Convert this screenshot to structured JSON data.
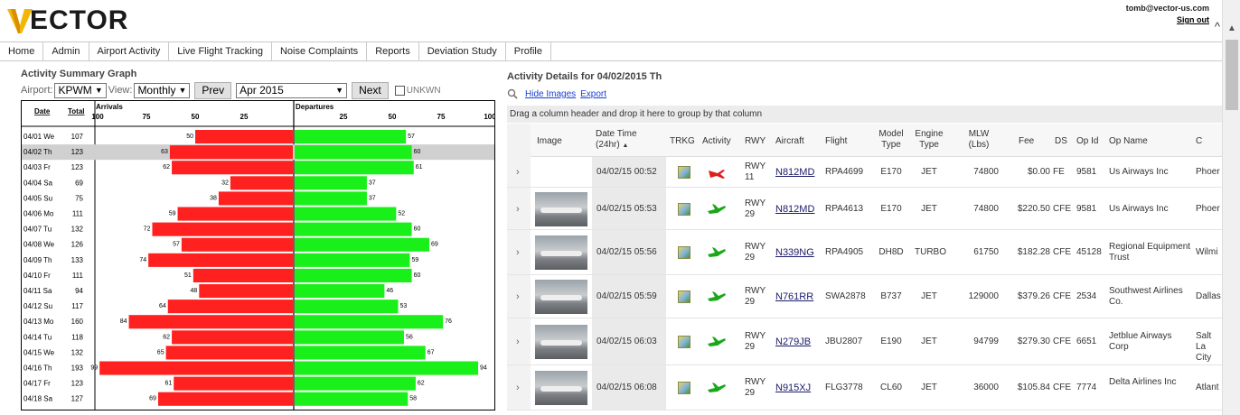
{
  "header": {
    "logo_text": "ECTOR",
    "user_email": "tomb@vector-us.com",
    "sign_out": "Sign out"
  },
  "nav": [
    "Home",
    "Admin",
    "Airport Activity",
    "Live Flight Tracking",
    "Noise Complaints",
    "Reports",
    "Deviation Study",
    "Profile"
  ],
  "summary": {
    "title": "Activity Summary Graph",
    "airport_label": "Airport:",
    "airport_value": "KPWM",
    "view_label": "View:",
    "view_value": "Monthly",
    "prev_label": "Prev",
    "month_value": "Apr 2015",
    "next_label": "Next",
    "unkwn_label": "UNKWN"
  },
  "chart_data": {
    "type": "bar",
    "columns": {
      "date": "Date",
      "total": "Total"
    },
    "arrivals_label": "Arrivals",
    "departures_label": "Departures",
    "arrival_ticks": [
      "100",
      "75",
      "50",
      "25"
    ],
    "departure_ticks": [
      "25",
      "50",
      "75",
      "100"
    ],
    "categories": [
      "04/01 We",
      "04/02 Th",
      "04/03 Fr",
      "04/04 Sa",
      "04/05 Su",
      "04/06 Mo",
      "04/07 Tu",
      "04/08 We",
      "04/09 Th",
      "04/10 Fr",
      "04/11 Sa",
      "04/12 Su",
      "04/13 Mo",
      "04/14 Tu",
      "04/15 We",
      "04/16 Th",
      "04/17 Fr",
      "04/18 Sa"
    ],
    "totals": [
      107,
      123,
      123,
      69,
      75,
      111,
      132,
      126,
      133,
      111,
      94,
      117,
      160,
      118,
      132,
      193,
      123,
      127
    ],
    "series": [
      {
        "name": "Arrivals",
        "values": [
          50,
          63,
          62,
          32,
          38,
          59,
          72,
          57,
          74,
          51,
          48,
          64,
          84,
          62,
          65,
          99,
          61,
          69
        ]
      },
      {
        "name": "Departures",
        "values": [
          57,
          60,
          61,
          37,
          37,
          52,
          60,
          69,
          59,
          60,
          46,
          53,
          76,
          56,
          67,
          94,
          62,
          58
        ]
      }
    ],
    "selected_index": 1,
    "xlim": [
      0,
      100
    ],
    "arrival_color": "#ff2020",
    "departure_color": "#19f019"
  },
  "details": {
    "title": "Activity Details for 04/02/2015 Th",
    "hide_images": "Hide Images",
    "export": "Export",
    "group_hint": "Drag a column header and drop it here to group by that column",
    "columns": [
      "Image",
      "Date Time (24hr)",
      "TRKG",
      "Activity",
      "RWY",
      "Aircraft",
      "Flight",
      "Model Type",
      "Engine Type",
      "MLW (Lbs)",
      "Fee",
      "DS",
      "Op Id",
      "Op Name",
      "C"
    ],
    "rows": [
      {
        "image": false,
        "datetime": "04/02/15 00:52",
        "activity": "arrival",
        "rwy": "RWY 11",
        "aircraft": "N812MD",
        "flight": "RPA4699",
        "model": "E170",
        "engine": "JET",
        "mlw": "74800",
        "fee": "$0.00",
        "ds": "FE",
        "opid": "9581",
        "opname": "Us Airways Inc",
        "city": "Phoer"
      },
      {
        "image": true,
        "datetime": "04/02/15 05:53",
        "activity": "departure",
        "rwy": "RWY 29",
        "aircraft": "N812MD",
        "flight": "RPA4613",
        "model": "E170",
        "engine": "JET",
        "mlw": "74800",
        "fee": "$220.50",
        "ds": "CFE",
        "opid": "9581",
        "opname": "Us Airways Inc",
        "city": "Phoer"
      },
      {
        "image": true,
        "datetime": "04/02/15 05:56",
        "activity": "departure",
        "rwy": "RWY 29",
        "aircraft": "N339NG",
        "flight": "RPA4905",
        "model": "DH8D",
        "engine": "TURBO",
        "mlw": "61750",
        "fee": "$182.28",
        "ds": "CFE",
        "opid": "45128",
        "opname": "Regional Equipment Trust",
        "city": "Wilmi"
      },
      {
        "image": true,
        "datetime": "04/02/15 05:59",
        "activity": "departure",
        "rwy": "RWY 29",
        "aircraft": "N761RR",
        "flight": "SWA2878",
        "model": "B737",
        "engine": "JET",
        "mlw": "129000",
        "fee": "$379.26",
        "ds": "CFE",
        "opid": "2534",
        "opname": "Southwest Airlines Co.",
        "city": "Dallas"
      },
      {
        "image": true,
        "datetime": "04/02/15 06:03",
        "activity": "departure",
        "rwy": "RWY 29",
        "aircraft": "N279JB",
        "flight": "JBU2807",
        "model": "E190",
        "engine": "JET",
        "mlw": "94799",
        "fee": "$279.30",
        "ds": "CFE",
        "opid": "6651",
        "opname": "Jetblue Airways Corp",
        "city": "Salt La City"
      },
      {
        "image": true,
        "datetime": "04/02/15 06:08",
        "activity": "departure",
        "rwy": "RWY 29",
        "aircraft": "N915XJ",
        "flight": "FLG3778",
        "model": "CL60",
        "engine": "JET",
        "mlw": "36000",
        "fee": "$105.84",
        "ds": "CFE",
        "opid": "7774",
        "opname": "Delta Airlines Inc",
        "city": "Atlant"
      }
    ]
  }
}
